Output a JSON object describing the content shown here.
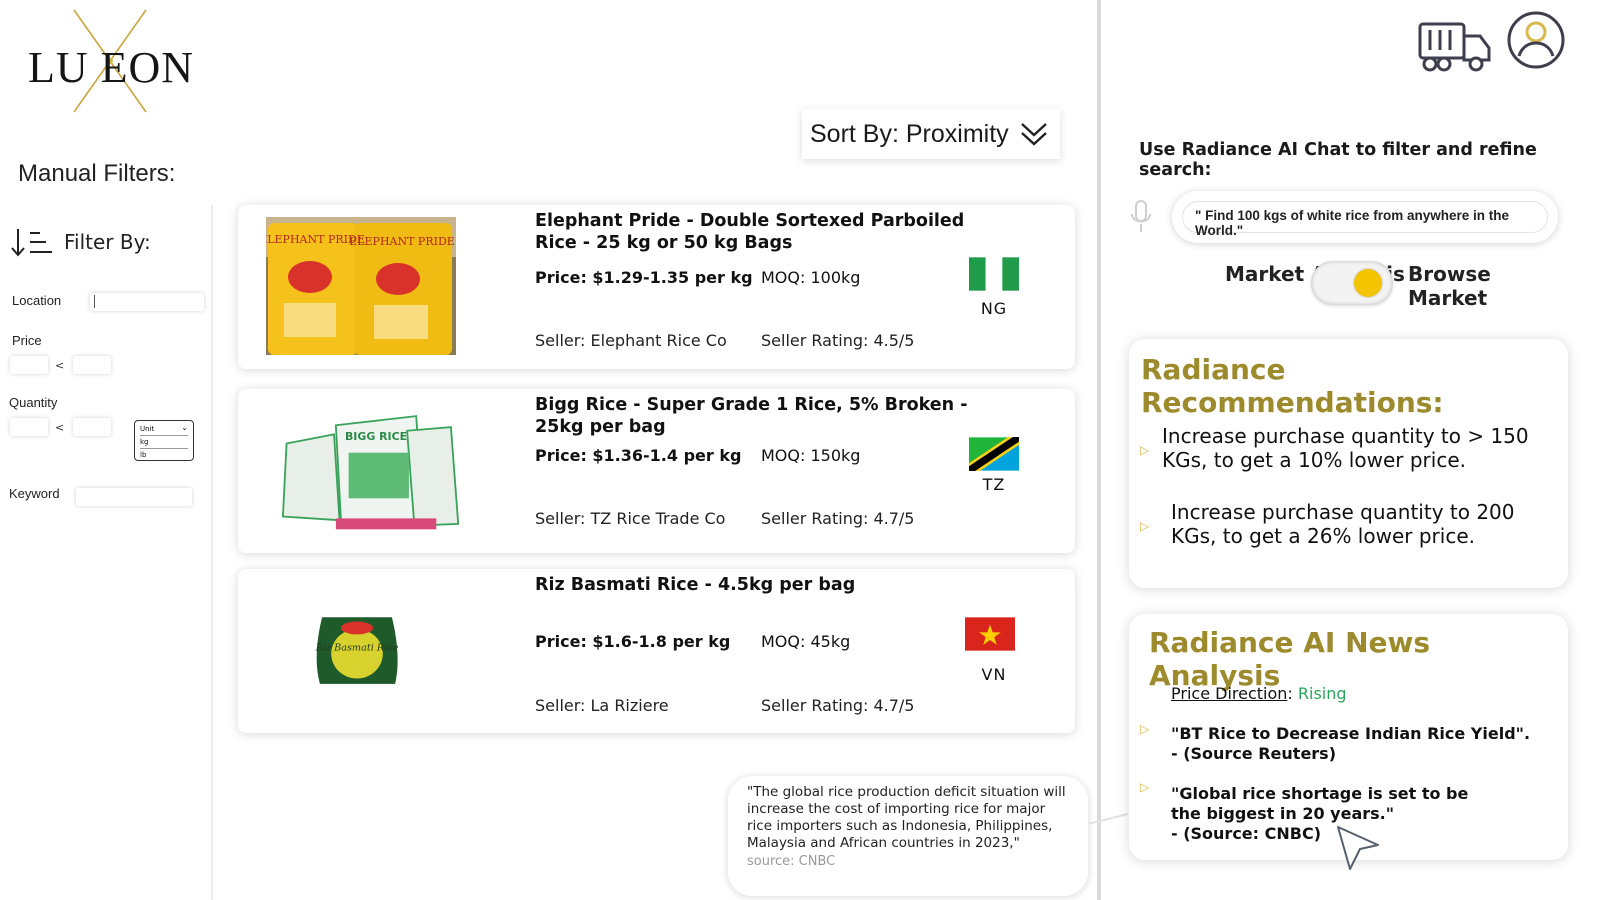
{
  "brand": {
    "logo_text": "LU EON"
  },
  "filters": {
    "heading": "Manual Filters:",
    "filter_by": "Filter By:",
    "location_label": "Location",
    "price_label": "Price",
    "quantity_label": "Quantity",
    "keyword_label": "Keyword",
    "less_than": "<",
    "unit_select": {
      "label": "Unit",
      "options": [
        "kg",
        "lb"
      ]
    }
  },
  "sort": {
    "label": "Sort By: Proximity"
  },
  "products": [
    {
      "title": "Elephant Pride - Double Sortexed Parboiled Rice - 25 kg or 50 kg Bags",
      "price": "Price: $1.29-1.35 per kg",
      "moq": "MOQ: 100kg",
      "seller": "Seller: Elephant Rice Co",
      "rating": "Seller Rating: 4.5/5",
      "country_code": "NG",
      "flag": "nigeria-flag"
    },
    {
      "title": "Bigg Rice - Super Grade 1 Rice, 5% Broken - 25kg per bag",
      "price": "Price: $1.36-1.4 per kg",
      "moq": "MOQ: 150kg",
      "seller": "Seller: TZ Rice Trade Co",
      "rating": "Seller Rating: 4.7/5",
      "country_code": "TZ",
      "flag": "tanzania-flag"
    },
    {
      "title": "Riz Basmati Rice -  4.5kg per bag",
      "price": "Price: $1.6-1.8 per kg",
      "moq": "MOQ: 45kg",
      "seller": "Seller: La Riziere",
      "rating": "Seller Rating: 4.7/5",
      "country_code": "VN",
      "flag": "vietnam-flag"
    }
  ],
  "product_images": {
    "elephant_pride_text": "ELEPHANT PRIDE",
    "bigg_rice_text": "BIGG RICE",
    "riz_basmati_text": "Riz Basmati Rice"
  },
  "quote": {
    "text": "\"The global rice production deficit situation will increase the cost of importing rice for major rice importers such as Indonesia, Philippines, Malaysia and African countries in 2023,\"",
    "source": "source: CNBC"
  },
  "ai": {
    "prompt": "Use Radiance AI Chat to filter and refine search:",
    "chat_value": "\" Find 100 kgs of white rice from anywhere in the World.\"",
    "toggle_left": "Market Analysis",
    "toggle_right": "Browse Market",
    "toggle_state": "Browse Market"
  },
  "recommendations": {
    "title": "Radiance Recommendations:",
    "items": [
      "Increase purchase quantity to > 150 KGs, to get a 10% lower price.",
      "Increase purchase quantity to 200 KGs, to get a 26% lower price."
    ]
  },
  "news": {
    "title": "Radiance AI News Analysis",
    "price_direction_label": "Price Direction",
    "price_direction_value": "Rising",
    "items": [
      {
        "headline": "\"BT Rice to Decrease Indian Rice Yield\".",
        "source": "- (Source Reuters)"
      },
      {
        "headline": "\"Global rice shortage is set to be the biggest in 20 years.\"",
        "source": "- (Source: CNBC)"
      }
    ]
  },
  "colors": {
    "gold": "#9c8a2c",
    "toggle_knob": "#f5c400",
    "rising": "#2aa65a",
    "triangle": "#d8b84a"
  },
  "icons": [
    "sort-icon",
    "chevron-down-icon",
    "truck-icon",
    "user-icon",
    "mic-icon",
    "cursor-icon",
    "triangle-bullet-icon"
  ]
}
